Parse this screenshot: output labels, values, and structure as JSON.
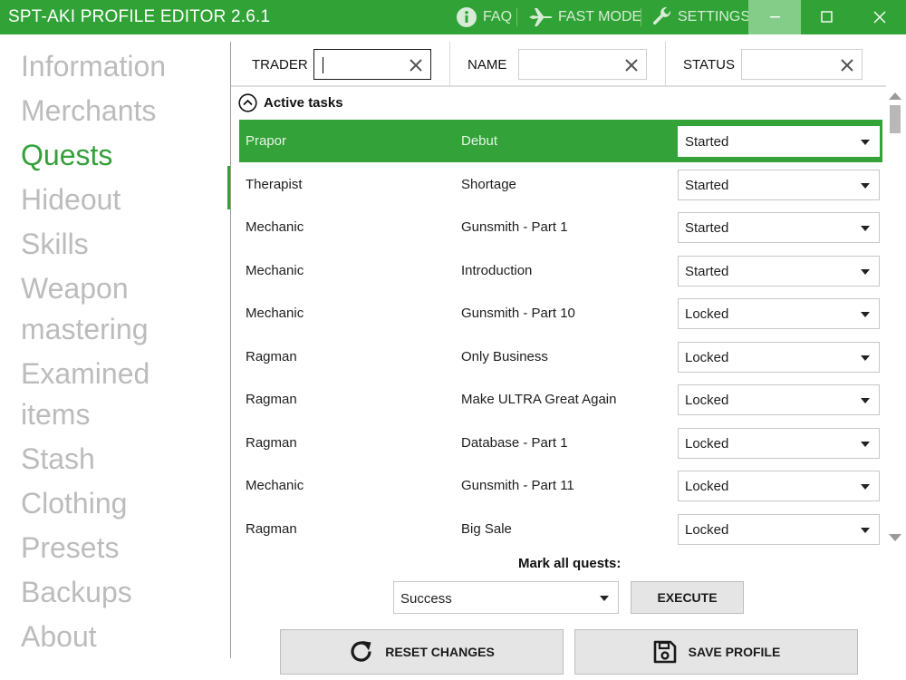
{
  "window": {
    "title": "SPT-AKI PROFILE EDITOR  2.6.1",
    "faq_label": "FAQ",
    "fast_mode_label": "FAST MODE",
    "settings_label": "SETTINGS",
    "accent_color": "#31a336"
  },
  "sidebar": {
    "items": [
      {
        "label": "Information"
      },
      {
        "label": "Merchants"
      },
      {
        "label": "Quests",
        "active": true
      },
      {
        "label": "Hideout"
      },
      {
        "label": "Skills"
      },
      {
        "label": "Weapon mastering"
      },
      {
        "label": "Examined items"
      },
      {
        "label": "Stash"
      },
      {
        "label": "Clothing"
      },
      {
        "label": "Presets"
      },
      {
        "label": "Backups"
      },
      {
        "label": "About"
      }
    ]
  },
  "filters": {
    "trader_label": "TRADER",
    "trader_value": "",
    "name_label": "NAME",
    "name_value": "",
    "status_label": "STATUS",
    "status_value": ""
  },
  "group": {
    "label": "Active tasks",
    "icon": "chevron-up-circle-icon"
  },
  "quests": [
    {
      "trader": "Prapor",
      "name": "Debut",
      "status": "Started",
      "selected": true
    },
    {
      "trader": "Therapist",
      "name": "Shortage",
      "status": "Started"
    },
    {
      "trader": "Mechanic",
      "name": "Gunsmith - Part 1",
      "status": "Started"
    },
    {
      "trader": "Mechanic",
      "name": "Introduction",
      "status": "Started"
    },
    {
      "trader": "Mechanic",
      "name": "Gunsmith - Part 10",
      "status": "Locked"
    },
    {
      "trader": "Ragman",
      "name": "Only Business",
      "status": "Locked"
    },
    {
      "trader": "Ragman",
      "name": "Make ULTRA Great Again",
      "status": "Locked"
    },
    {
      "trader": "Ragman",
      "name": "Database - Part 1",
      "status": "Locked"
    },
    {
      "trader": "Mechanic",
      "name": "Gunsmith - Part 11",
      "status": "Locked"
    },
    {
      "trader": "Ragman",
      "name": "Big Sale",
      "status": "Locked"
    }
  ],
  "bulk": {
    "label": "Mark all quests:",
    "selected": "Success",
    "execute_label": "EXECUTE"
  },
  "actions": {
    "reset_label": "RESET CHANGES",
    "save_label": "SAVE PROFILE"
  }
}
